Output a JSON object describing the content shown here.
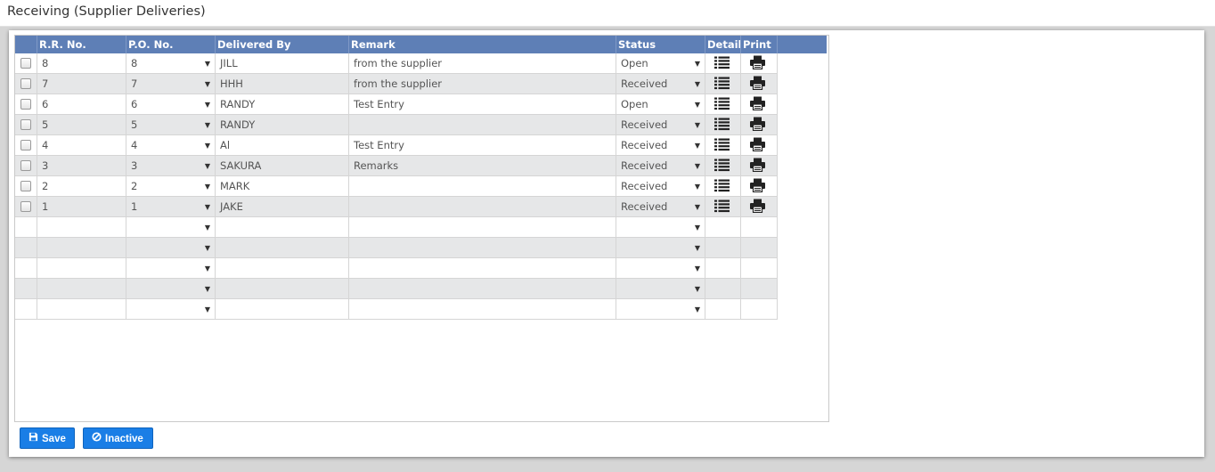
{
  "window": {
    "title": "Receiving (Supplier Deliveries)"
  },
  "grid": {
    "columns": [
      "R.R. No.",
      "P.O. No.",
      "Delivered By",
      "Remark",
      "Status",
      "Detail",
      "Print"
    ],
    "rows": [
      {
        "rr": "8",
        "po": "8",
        "delivered_by": "JILL",
        "remark": "from the supplier",
        "status": "Open"
      },
      {
        "rr": "7",
        "po": "7",
        "delivered_by": "HHH",
        "remark": "from the supplier",
        "status": "Received"
      },
      {
        "rr": "6",
        "po": "6",
        "delivered_by": "RANDY",
        "remark": "Test Entry",
        "status": "Open"
      },
      {
        "rr": "5",
        "po": "5",
        "delivered_by": "RANDY",
        "remark": "",
        "status": "Received"
      },
      {
        "rr": "4",
        "po": "4",
        "delivered_by": "Al",
        "remark": "Test Entry",
        "status": "Received"
      },
      {
        "rr": "3",
        "po": "3",
        "delivered_by": "SAKURA",
        "remark": "Remarks",
        "status": "Received"
      },
      {
        "rr": "2",
        "po": "2",
        "delivered_by": "MARK",
        "remark": "",
        "status": "Received"
      },
      {
        "rr": "1",
        "po": "1",
        "delivered_by": "JAKE",
        "remark": "",
        "status": "Received"
      }
    ],
    "empty_rows": 5,
    "detail_icon": "list-icon",
    "print_icon": "printer-icon",
    "dropdown_icon": "dropdown-arrow-icon"
  },
  "buttons": {
    "save": {
      "label": "Save",
      "icon": "save-icon"
    },
    "inactive": {
      "label": "Inactive",
      "icon": "ban-icon"
    }
  },
  "colors": {
    "header_bg": "#5e7fb6",
    "alt_row_bg": "#e6e7e8",
    "button_bg": "#1a7ee6"
  }
}
